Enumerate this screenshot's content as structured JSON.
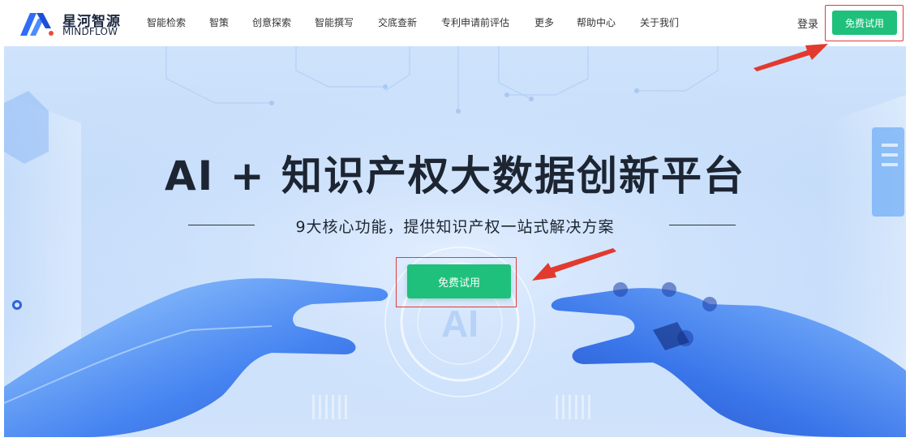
{
  "logo": {
    "name_cn": "星河智源",
    "name_en": "MINDFLOW"
  },
  "nav": {
    "items": [
      "智能检索",
      "智策",
      "创意探索",
      "智能撰写",
      "交底查新",
      "专利申请前评估",
      "更多",
      "帮助中心",
      "关于我们"
    ],
    "login": "登录",
    "trial_button": "免费试用"
  },
  "hero": {
    "title": "AI + 知识产权大数据创新平台",
    "subtitle": "9大核心功能，提供知识产权一站式解决方案",
    "cta_button": "免费试用",
    "watermark": "AI"
  },
  "colors": {
    "accent_green": "#1fc07b",
    "annotation_red": "#e03c3c",
    "hero_background": "#c8ddfa",
    "title_text": "#1d2532"
  },
  "icons": [
    "mindflow-logo-icon",
    "annotation-arrow-icon"
  ]
}
